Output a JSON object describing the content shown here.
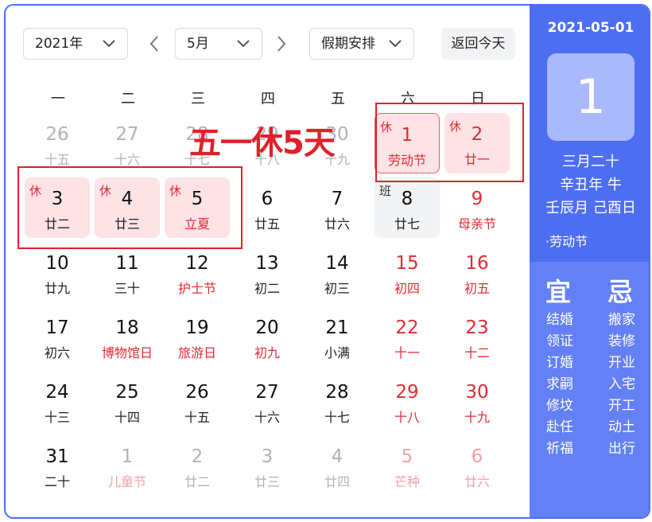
{
  "toolbar": {
    "year": "2021年",
    "month": "5月",
    "holiday": "假期安排",
    "today_button": "返回今天"
  },
  "weekdays": [
    "一",
    "二",
    "三",
    "四",
    "五",
    "六",
    "日"
  ],
  "days": [
    {
      "num": "26",
      "sub": "十五"
    },
    {
      "num": "27",
      "sub": "十六"
    },
    {
      "num": "28",
      "sub": "十七"
    },
    {
      "num": "29",
      "sub": "十八"
    },
    {
      "num": "30",
      "sub": "十九"
    },
    {
      "num": "1",
      "sub": "劳动节",
      "tag": "休"
    },
    {
      "num": "2",
      "sub": "廿一",
      "tag": "休"
    },
    {
      "num": "3",
      "sub": "廿二",
      "tag": "休"
    },
    {
      "num": "4",
      "sub": "廿三",
      "tag": "休"
    },
    {
      "num": "5",
      "sub": "立夏",
      "tag": "休"
    },
    {
      "num": "6",
      "sub": "廿五"
    },
    {
      "num": "7",
      "sub": "廿六"
    },
    {
      "num": "8",
      "sub": "廿七",
      "tag": "班"
    },
    {
      "num": "9",
      "sub": "母亲节"
    },
    {
      "num": "10",
      "sub": "廿九"
    },
    {
      "num": "11",
      "sub": "三十"
    },
    {
      "num": "12",
      "sub": "护士节"
    },
    {
      "num": "13",
      "sub": "初二"
    },
    {
      "num": "14",
      "sub": "初三"
    },
    {
      "num": "15",
      "sub": "初四"
    },
    {
      "num": "16",
      "sub": "初五"
    },
    {
      "num": "17",
      "sub": "初六"
    },
    {
      "num": "18",
      "sub": "博物馆日"
    },
    {
      "num": "19",
      "sub": "旅游日"
    },
    {
      "num": "20",
      "sub": "初九"
    },
    {
      "num": "21",
      "sub": "小满"
    },
    {
      "num": "22",
      "sub": "十一"
    },
    {
      "num": "23",
      "sub": "十二"
    },
    {
      "num": "24",
      "sub": "十三"
    },
    {
      "num": "25",
      "sub": "十四"
    },
    {
      "num": "26",
      "sub": "十五"
    },
    {
      "num": "27",
      "sub": "十六"
    },
    {
      "num": "28",
      "sub": "十七"
    },
    {
      "num": "29",
      "sub": "十八"
    },
    {
      "num": "30",
      "sub": "十九"
    },
    {
      "num": "31",
      "sub": "二十"
    },
    {
      "num": "1",
      "sub": "儿童节"
    },
    {
      "num": "2",
      "sub": "廿二"
    },
    {
      "num": "3",
      "sub": "廿三"
    },
    {
      "num": "4",
      "sub": "廿四"
    },
    {
      "num": "5",
      "sub": "芒种"
    },
    {
      "num": "6",
      "sub": "廿六"
    }
  ],
  "annotation": "五一休5天",
  "side": {
    "date": "2021-05-01",
    "day": "1",
    "lunar_lines": [
      "三月二十",
      "辛丑年 牛",
      "壬辰月 己酉日"
    ],
    "festival": "·劳动节",
    "yi_title": "宜",
    "ji_title": "忌",
    "yi": [
      "结婚",
      "领证",
      "订婚",
      "求嗣",
      "修坟",
      "赴任",
      "祈福"
    ],
    "ji": [
      "搬家",
      "装修",
      "开业",
      "入宅",
      "开工",
      "动土",
      "出行"
    ]
  },
  "colors": {
    "accent": "#4e6ef2",
    "holiday_red": "#e02b35",
    "rest_bg": "#fde3e5"
  }
}
